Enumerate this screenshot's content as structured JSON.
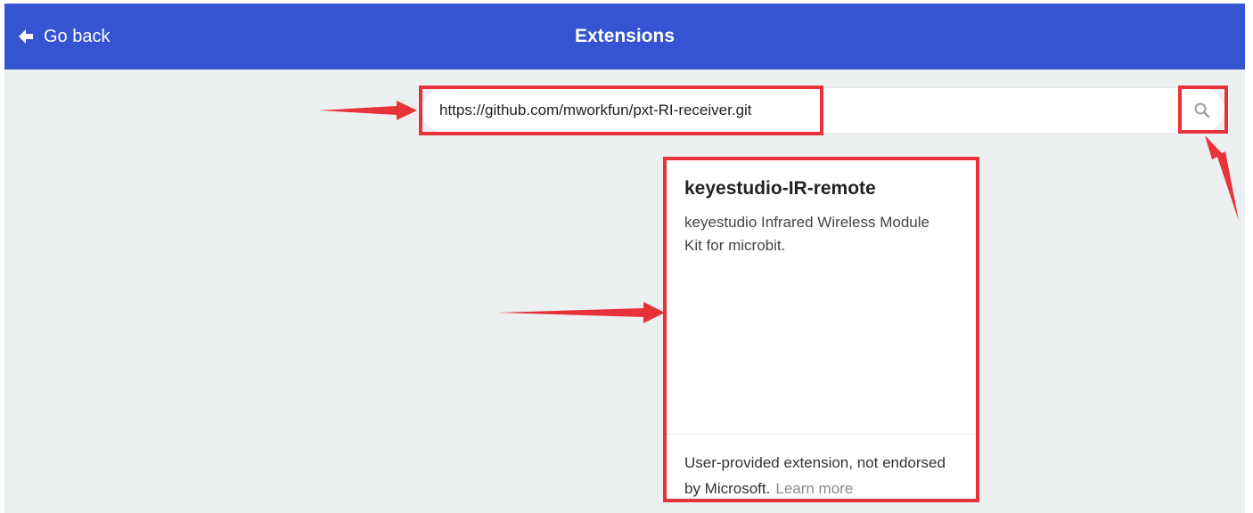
{
  "header": {
    "back_label": "Go back",
    "title": "Extensions",
    "bar_color": "#3454d1"
  },
  "search": {
    "value": "https://github.com/mworkfun/pxt-RI-receiver.git",
    "button_icon": "search-icon"
  },
  "result_card": {
    "title": "keyestudio-IR-remote",
    "description": "keyestudio Infrared Wireless Module Kit for microbit.",
    "footer_note": "User-provided extension, not endorsed by Microsoft.",
    "learn_more": "Learn more"
  },
  "annotation_color": "#e8323a"
}
